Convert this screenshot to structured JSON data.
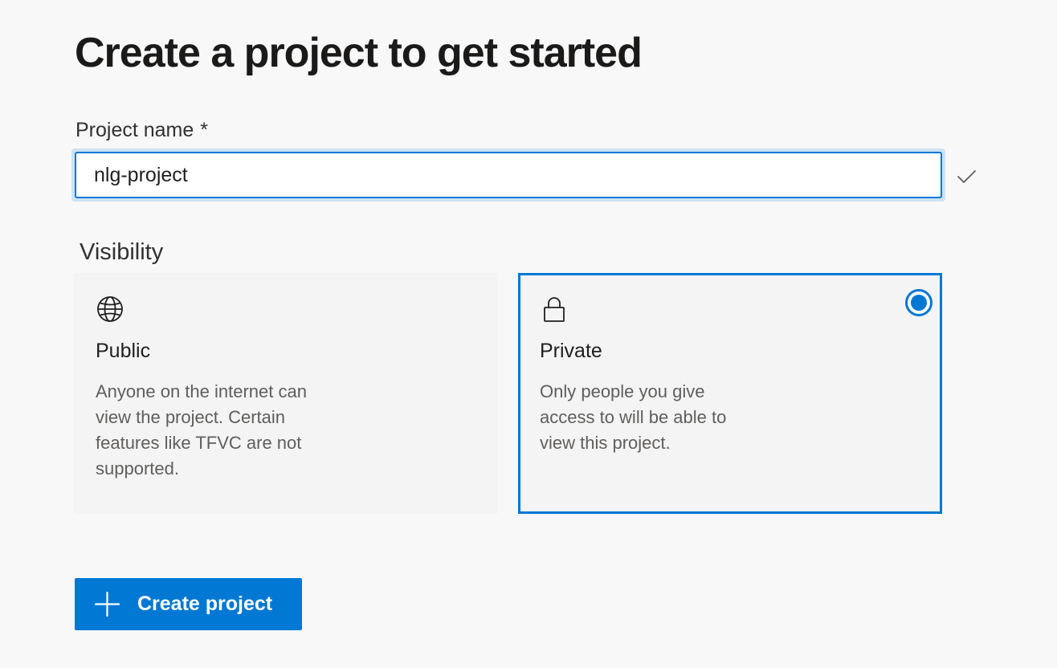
{
  "page": {
    "title": "Create a project to get started"
  },
  "project_name": {
    "label": "Project name",
    "required_marker": "*",
    "value": "nlg-project",
    "valid_icon": "checkmark-icon"
  },
  "visibility": {
    "label": "Visibility",
    "selected": "private",
    "options": [
      {
        "id": "public",
        "icon": "globe-icon",
        "title": "Public",
        "description": "Anyone on the internet can view the project. Certain features like TFVC are not supported."
      },
      {
        "id": "private",
        "icon": "lock-icon",
        "title": "Private",
        "description": "Only people you give access to will be able to view this project."
      }
    ]
  },
  "actions": {
    "create_label": "Create project",
    "create_icon": "plus-icon"
  },
  "colors": {
    "accent": "#0078d4",
    "background": "#f8f8f8",
    "card_background": "#f4f4f4",
    "secondary_text": "#605e5c"
  }
}
